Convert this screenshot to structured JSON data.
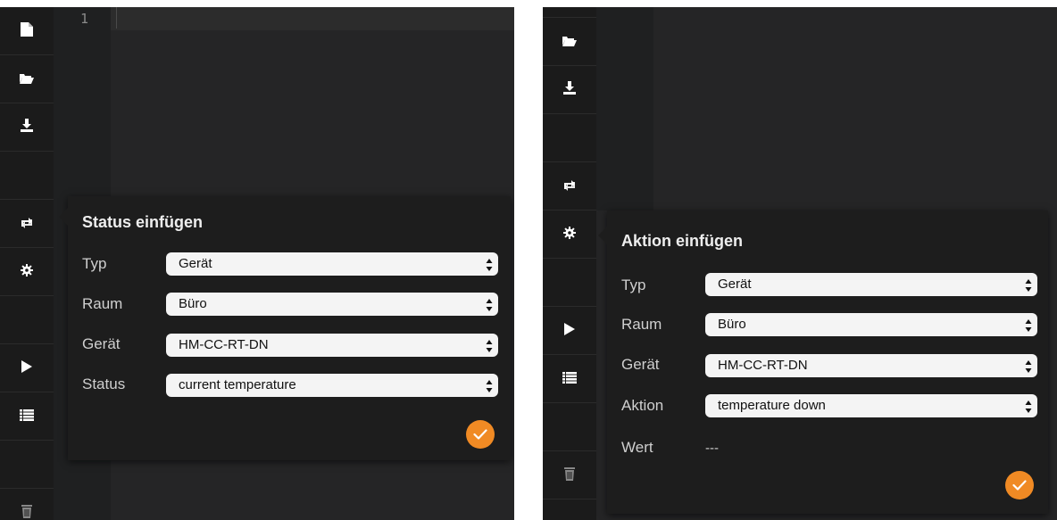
{
  "left": {
    "line_number": "1",
    "toolbar_icons": [
      "new-file-icon",
      "open-folder-icon",
      "download-icon",
      "repeat-icon",
      "gear-icon",
      "play-icon",
      "list-icon",
      "trash-icon"
    ],
    "popover": {
      "title": "Status einfügen",
      "fields": [
        {
          "label": "Typ",
          "value": "Gerät"
        },
        {
          "label": "Raum",
          "value": "Büro"
        },
        {
          "label": "Gerät",
          "value": "HM-CC-RT-DN"
        },
        {
          "label": "Status",
          "value": "current temperature"
        }
      ]
    }
  },
  "right": {
    "toolbar_icons": [
      "open-folder-icon",
      "download-icon",
      "repeat-icon",
      "gear-icon",
      "play-icon",
      "list-icon",
      "trash-icon"
    ],
    "popover": {
      "title": "Aktion einfügen",
      "fields": [
        {
          "label": "Typ",
          "value": "Gerät"
        },
        {
          "label": "Raum",
          "value": "Büro"
        },
        {
          "label": "Gerät",
          "value": "HM-CC-RT-DN"
        },
        {
          "label": "Aktion",
          "value": "temperature down"
        }
      ],
      "wert_label": "Wert",
      "wert_value": "---"
    }
  },
  "colors": {
    "accent": "#f08a24",
    "panel_bg": "#252526",
    "toolbar_bg": "#1b1b1b",
    "popover_bg": "#1d1d1d"
  }
}
